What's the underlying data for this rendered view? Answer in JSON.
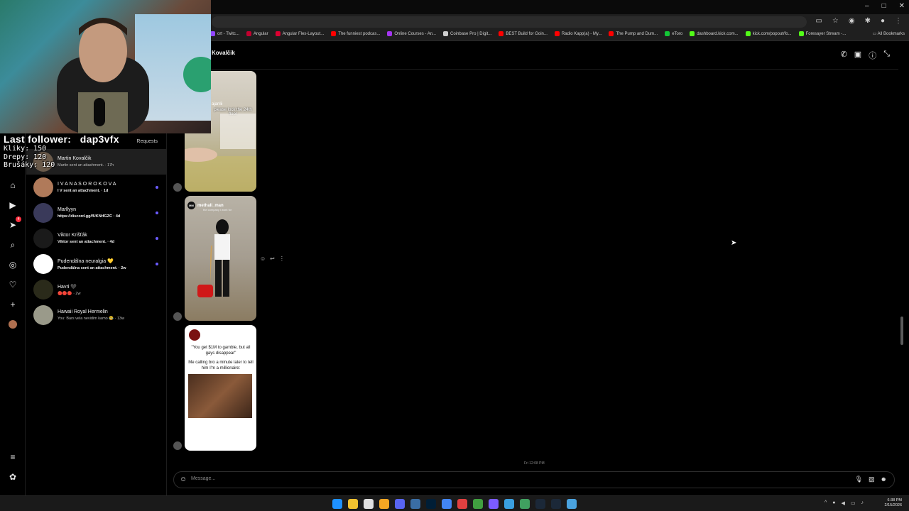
{
  "browser": {
    "window_controls": [
      "–",
      "□",
      "✕"
    ],
    "bookmarks": [
      {
        "label": "ort - Twitc...",
        "color": "#9146ff"
      },
      {
        "label": "Angular",
        "color": "#c3002f"
      },
      {
        "label": "Angular Flex-Layout...",
        "color": "#dd0031"
      },
      {
        "label": "The funniest podcas...",
        "color": "#ff0000"
      },
      {
        "label": "Online Courses - An...",
        "color": "#a435f0"
      },
      {
        "label": "Coinbase Pro | Digit...",
        "color": "#cccccc"
      },
      {
        "label": "BEST Build for Goin...",
        "color": "#ff0000"
      },
      {
        "label": "Radio Kapp(a) - My...",
        "color": "#ff0000"
      },
      {
        "label": "The Pump and Dum...",
        "color": "#ff0000"
      },
      {
        "label": "eToro",
        "color": "#13c636"
      },
      {
        "label": "dashboard.kick.com...",
        "color": "#53fc18"
      },
      {
        "label": "kick.com/popout/fo...",
        "color": "#53fc18"
      },
      {
        "label": "Foresayer Stream -...",
        "color": "#53fc18"
      }
    ],
    "all_bookmarks": "All Bookmarks"
  },
  "sidebar": {
    "requests_label": "Requests",
    "notification_count": "4",
    "conversations": [
      {
        "name": "Martin Kovalčik",
        "preview": "Martin sent an attachment. · 17h",
        "unread": false,
        "active": true,
        "avatar_color": "#6a5a4a"
      },
      {
        "name": "I V A N A S O R O K O V A",
        "preview": "I V sent an attachment. · 1d",
        "unread": true,
        "active": false,
        "avatar_color": "#b07a5a"
      },
      {
        "name": "Marllyyn",
        "preview": "https://discord.gg/fUKNtfGZC · 4d",
        "unread": true,
        "active": false,
        "avatar_color": "#3a3a5a"
      },
      {
        "name": "Viktor Krišťák",
        "preview": "Viktor sent an attachment. · 4d",
        "unread": true,
        "active": false,
        "avatar_color": "#1a1a1a"
      },
      {
        "name": "Pudendálna neuralgia 💛",
        "preview": "Pudendálna sent an attachment. · 2w",
        "unread": true,
        "active": false,
        "avatar_color": "#ffffff"
      },
      {
        "name": "Havri 🖤",
        "preview": "🔴🔴🔴 · 2w",
        "unread": false,
        "active": false,
        "avatar_color": "#2a2a1a"
      },
      {
        "name": "Hawaii Royal Hermelin",
        "preview": "You: Bars vela nevidim kamo 😂 · 13w",
        "unread": false,
        "active": false,
        "avatar_color": "#9a9a8a"
      }
    ]
  },
  "thread": {
    "contact_name": "Kovalčik",
    "media_posts": [
      {
        "top_label": "ajanlii",
        "caption": "please lock the 24th floor"
      },
      {
        "username": "methali_man",
        "subtitle": "the company i work for"
      },
      {
        "text_1": "\"You get $1M to gamble, but all gays disappear\"",
        "text_2": "Me calling bro a minute later to tell him I'm a millionaire:"
      }
    ],
    "timestamp": "Fri 12:08 PM",
    "composer_placeholder": "Message..."
  },
  "overlay": {
    "last_follower_label": "Last follower:",
    "last_follower_name": "dap3vfx",
    "stats": [
      "Kliky: 150",
      "Drepy: 120",
      "Brušáky: 120"
    ]
  },
  "taskbar": {
    "time": "6:38 PM",
    "date": "2/15/2026",
    "apps": [
      "#1e90ff",
      "#f2c230",
      "#e0e0e0",
      "#f5a623",
      "#5865f2",
      "#3a6ea5",
      "#001e36",
      "#4285f4",
      "#e04040",
      "#40a040",
      "#7b5cff",
      "#3aa0e0",
      "#40a060",
      "#1b2838",
      "#1b2838",
      "#4aa3df"
    ]
  }
}
